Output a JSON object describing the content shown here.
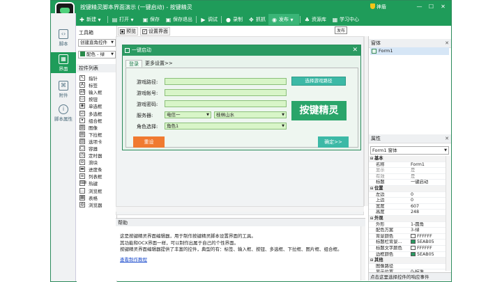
{
  "window": {
    "title": "按键精灵脚本界面演示 (一键启动) - 按键精灵",
    "shenqi": "神盾",
    "controls": {
      "minimize": "—",
      "maximize": "☐",
      "close": "✕"
    }
  },
  "toolbar": {
    "items": [
      {
        "label": "新建",
        "icon": "plus-icon",
        "glyph": "✚"
      },
      {
        "label": "打开",
        "icon": "folder-icon",
        "glyph": "▤"
      },
      {
        "label": "保存",
        "icon": "save-icon",
        "glyph": "▣"
      },
      {
        "label": "保存退出",
        "icon": "save-exit-icon",
        "glyph": "▣"
      },
      {
        "label": "调试",
        "icon": "play-icon",
        "glyph": "▶"
      },
      {
        "label": "录制",
        "icon": "record-icon",
        "glyph": "●"
      },
      {
        "label": "抓抓",
        "icon": "grab-icon",
        "glyph": "✥"
      },
      {
        "label": "发布",
        "icon": "publish-icon",
        "glyph": "◉"
      },
      {
        "label": "资源库",
        "icon": "library-icon",
        "glyph": "♣"
      },
      {
        "label": "学习中心",
        "icon": "learn-icon",
        "glyph": "▦"
      }
    ],
    "tooltip": "发布"
  },
  "leftnav": {
    "items": [
      {
        "label": "脚本",
        "glyph": "‹›"
      },
      {
        "label": "界面",
        "glyph": "▦"
      },
      {
        "label": "附件",
        "glyph": "⌘"
      },
      {
        "label": "脚本属性",
        "glyph": "i"
      }
    ]
  },
  "toolbox": {
    "title": "工具箱",
    "dropdown1": "创建直角控件",
    "dropdown2": "配色 - 绿",
    "list_header": "控件列表",
    "controls": [
      {
        "label": "指针",
        "glyph": "↖"
      },
      {
        "label": "标签",
        "glyph": "A"
      },
      {
        "label": "输入框",
        "glyph": "ab"
      },
      {
        "label": "按钮",
        "glyph": "▭"
      },
      {
        "label": "单选框",
        "glyph": "◉"
      },
      {
        "label": "多选框",
        "glyph": "☑"
      },
      {
        "label": "组合框",
        "glyph": "▾"
      },
      {
        "label": "图像",
        "glyph": "▨"
      },
      {
        "label": "下拉框",
        "glyph": "▤"
      },
      {
        "label": "选项卡",
        "glyph": "▥"
      },
      {
        "label": "容器",
        "glyph": "▢"
      },
      {
        "label": "定时器",
        "glyph": "◷"
      },
      {
        "label": "滑块",
        "glyph": "⊖"
      },
      {
        "label": "进度条",
        "glyph": "▬"
      },
      {
        "label": "列表框",
        "glyph": "≡"
      },
      {
        "label": "热键",
        "glyph": "⌨"
      },
      {
        "label": "浏览框",
        "glyph": "…"
      },
      {
        "label": "表格",
        "glyph": "▦"
      },
      {
        "label": "浏览器",
        "glyph": "◍"
      }
    ]
  },
  "design": {
    "tabs": [
      {
        "label": "预览",
        "check": "▪"
      },
      {
        "label": "设置界面",
        "check": "✓"
      }
    ]
  },
  "form": {
    "title": "一键启动",
    "close": "✕",
    "tabs": [
      "登录",
      "更多设置>>"
    ],
    "fields": {
      "path_label": "游戏路径:",
      "account_label": "游戏帐号:",
      "password_label": "游戏密码:",
      "server_label": "服务器:",
      "server_value": "电信一",
      "server2_value": "桂林山水",
      "role_label": "角色选择:",
      "role_value": "角色1"
    },
    "path_button": "选择游戏路径",
    "logo_text": "按键精灵",
    "reset_button": "重设",
    "ok_button": "确定>>"
  },
  "help": {
    "header": "帮助",
    "lines": [
      "这是按键精灵界面编辑器，用于制作按键精灵脚本设置界面的工具。",
      "其功能和OCX界面一样，可以制作出属于自己的个性界面。",
      "按键精灵界面编辑器提供了丰富的控件，典型的有：标签、输入框、按钮、多选框、下拉框、图片框、组合框。"
    ],
    "link": "查看制作教程"
  },
  "right": {
    "form_panel": {
      "header": "窗体",
      "item": "Form1",
      "close": "✕"
    },
    "props_panel": {
      "header": "属性",
      "close": "✕",
      "selector": "Form1 窗体",
      "categories": [
        {
          "name": "基本",
          "rows": [
            {
              "name": "名称",
              "value": "Form1"
            },
            {
              "name": "显示",
              "value": "是",
              "dim": true
            },
            {
              "name": "有效",
              "value": "是",
              "dim": true
            },
            {
              "name": "标题",
              "value": "一键启动"
            }
          ]
        },
        {
          "name": "位置",
          "rows": [
            {
              "name": "左边",
              "value": "0"
            },
            {
              "name": "上边",
              "value": "0"
            },
            {
              "name": "宽度",
              "value": "607"
            },
            {
              "name": "高度",
              "value": "248"
            }
          ]
        },
        {
          "name": "外观",
          "rows": [
            {
              "name": "外形",
              "value": "1-圆角"
            },
            {
              "name": "配色方案",
              "value": "3-绿"
            },
            {
              "name": "背景颜色",
              "value": "FFFFFF",
              "swatch": "#ffffff"
            },
            {
              "name": "标题栏背景...",
              "value": "5EAB05",
              "swatch": "#2a9a62"
            },
            {
              "name": "标题文字颜色",
              "value": "FFFFFF",
              "swatch": "#ffffff"
            },
            {
              "name": "边框颜色",
              "value": "5EAB05",
              "swatch": "#2a9a62"
            }
          ]
        },
        {
          "name": "其他",
          "rows": [
            {
              "name": "图像路径",
              "value": ""
            },
            {
              "name": "显示位置",
              "value": "0-标准"
            }
          ]
        }
      ],
      "event_bar": "点击这里选择控件的响应事件"
    }
  }
}
